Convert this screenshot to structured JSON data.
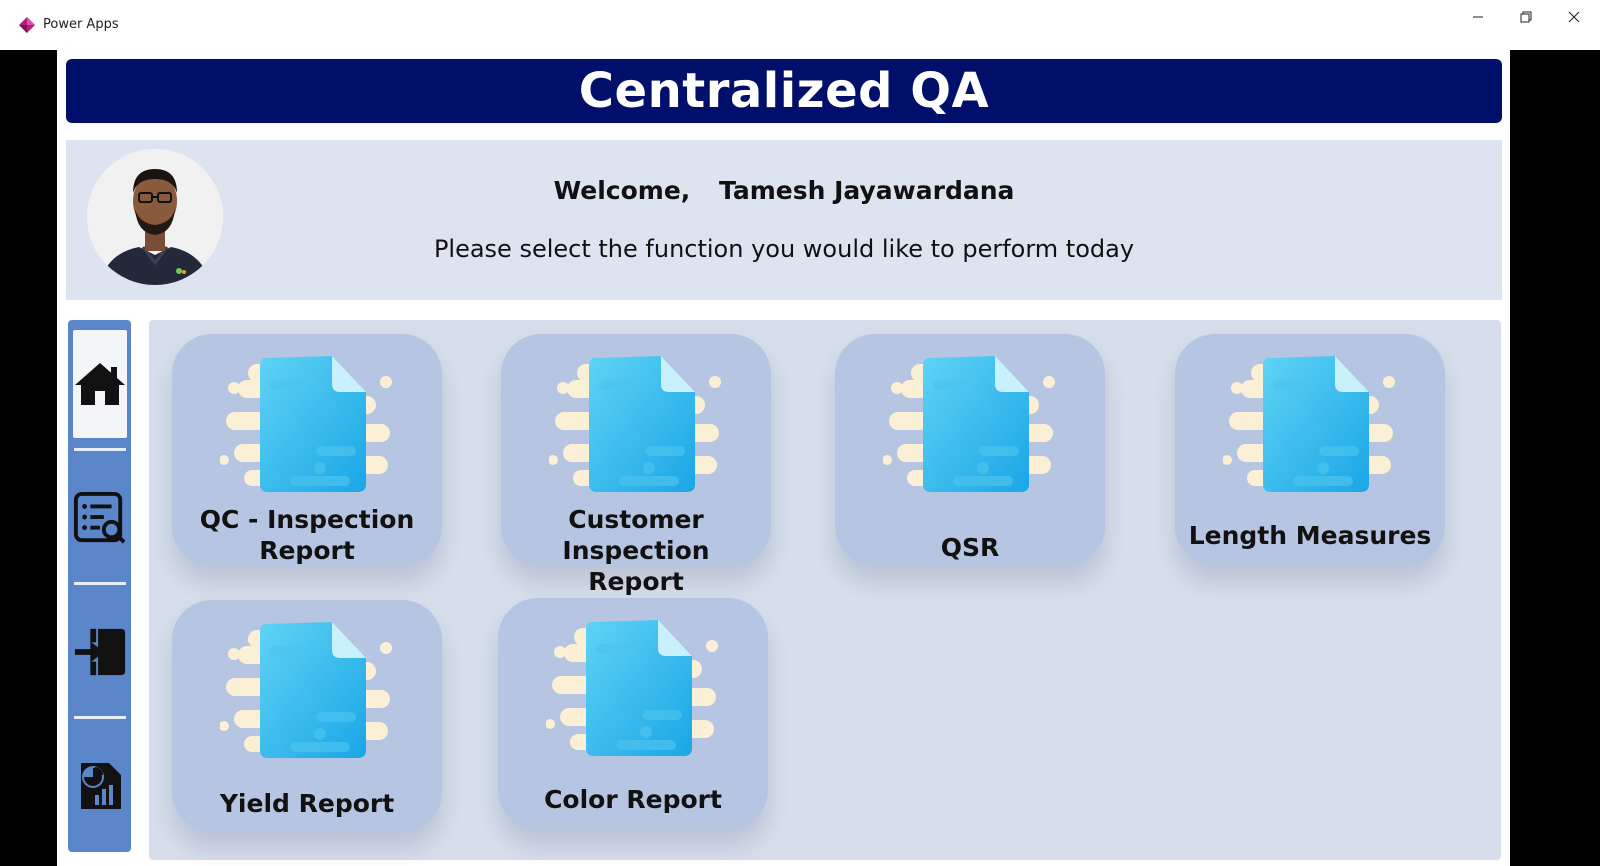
{
  "window": {
    "app_title": "Power Apps",
    "controls": {
      "minimize_icon": "minimize-icon",
      "restore_icon": "restore-icon",
      "close_icon": "close-icon"
    }
  },
  "header": {
    "title": "Centralized QA",
    "bg_color": "#00106a"
  },
  "welcome": {
    "greeting": "Welcome,",
    "user_name": "Tamesh Jayawardana",
    "subtitle": "Please select the function you would like to perform today"
  },
  "sidenav": {
    "items": [
      {
        "icon": "home-icon",
        "active": true
      },
      {
        "icon": "list-search-icon",
        "active": false
      },
      {
        "icon": "sign-in-icon",
        "active": false
      },
      {
        "icon": "report-chart-icon",
        "active": false
      }
    ]
  },
  "cards": [
    {
      "label_line1": "QC - Inspection",
      "label_line2": "Report",
      "icon": "document-icon"
    },
    {
      "label_line1": "Customer Inspection",
      "label_line2": "Report",
      "icon": "document-icon"
    },
    {
      "label_line1": "QSR",
      "label_line2": "",
      "icon": "document-icon"
    },
    {
      "label_line1": "Length Measures",
      "label_line2": "",
      "icon": "document-icon"
    },
    {
      "label_line1": "Yield Report",
      "label_line2": "",
      "icon": "document-icon"
    },
    {
      "label_line1": "Color Report",
      "label_line2": "",
      "icon": "document-icon"
    }
  ]
}
